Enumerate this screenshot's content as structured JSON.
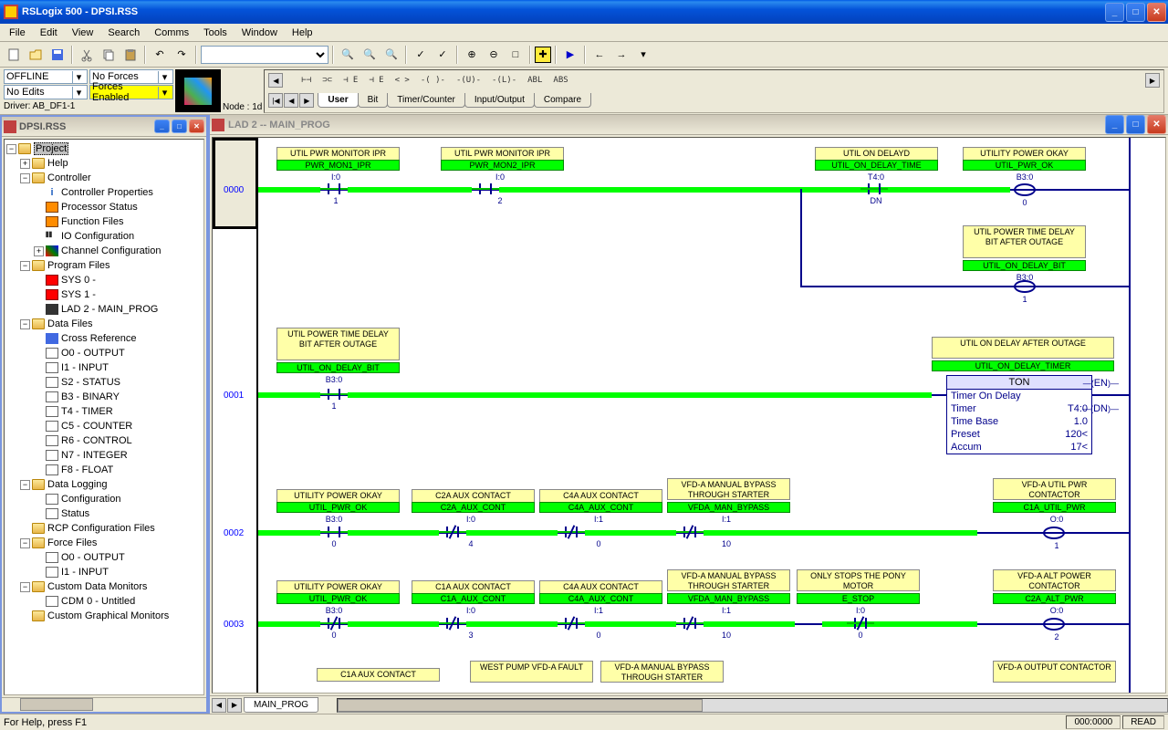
{
  "app": {
    "title": "RSLogix 500 - DPSI.RSS"
  },
  "menu": [
    "File",
    "Edit",
    "View",
    "Search",
    "Comms",
    "Tools",
    "Window",
    "Help"
  ],
  "status": {
    "mode": "OFFLINE",
    "forces": "No Forces",
    "edits": "No Edits",
    "forces_enabled": "Forces Enabled",
    "driver": "Driver: AB_DF1-1",
    "node": "Node :  1d"
  },
  "instr_symbols": [
    "⊢⊣",
    "⊃⊂",
    "⊣ E",
    "⊣ E",
    "< >",
    "-( )-",
    "-(U)-",
    "-(L)-",
    "ABL",
    "ABS"
  ],
  "instr_tabs": [
    "User",
    "Bit",
    "Timer/Counter",
    "Input/Output",
    "Compare"
  ],
  "tree_title": "DPSI.RSS",
  "tree": {
    "root": "Project",
    "help": "Help",
    "controller": "Controller",
    "controller_children": [
      "Controller Properties",
      "Processor Status",
      "Function Files",
      "IO Configuration",
      "Channel Configuration"
    ],
    "program_files": "Program Files",
    "pf_children": [
      "SYS 0 -",
      "SYS 1 -",
      "LAD 2 - MAIN_PROG"
    ],
    "data_files": "Data Files",
    "df_children": [
      "Cross Reference",
      "O0 - OUTPUT",
      "I1 - INPUT",
      "S2 - STATUS",
      "B3 - BINARY",
      "T4 - TIMER",
      "C5 - COUNTER",
      "R6 - CONTROL",
      "N7 - INTEGER",
      "F8 - FLOAT"
    ],
    "data_logging": "Data Logging",
    "dl_children": [
      "Configuration",
      "Status"
    ],
    "rcp": "RCP Configuration Files",
    "force_files": "Force Files",
    "ff_children": [
      "O0 - OUTPUT",
      "I1 - INPUT"
    ],
    "cdm": "Custom Data Monitors",
    "cdm_children": [
      "CDM 0 - Untitled"
    ],
    "cgm": "Custom Graphical Monitors"
  },
  "ladder": {
    "title": "LAD 2 -- MAIN_PROG",
    "tab": "MAIN_PROG",
    "rungs": [
      "0000",
      "0001",
      "0002",
      "0003"
    ],
    "r0": {
      "c1_desc": "UTIL PWR MONITOR IPR",
      "c1_tag": "PWR_MON1_IPR",
      "c1_addr": "I:0",
      "c1_bit": "1",
      "c2_desc": "UTIL PWR MONITOR IPR",
      "c2_tag": "PWR_MON2_IPR",
      "c2_addr": "I:0",
      "c2_bit": "2",
      "c3_desc": "UTIL ON DELAYD",
      "c3_tag": "UTIL_ON_DELAY_TIME",
      "c3_addr": "T4:0",
      "c3_bit": "DN",
      "o1_desc": "UTILITY POWER OKAY",
      "o1_tag": "UTIL_PWR_OK",
      "o1_addr": "B3:0",
      "o1_bit": "0",
      "o2_desc": "UTIL POWER TIME DELAY BIT AFTER OUTAGE",
      "o2_tag": "UTIL_ON_DELAY_BIT",
      "o2_addr": "B3:0",
      "o2_bit": "1"
    },
    "r1": {
      "c1_desc": "UTIL POWER TIME DELAY BIT AFTER OUTAGE",
      "c1_tag": "UTIL_ON_DELAY_BIT",
      "c1_addr": "B3:0",
      "c1_bit": "1",
      "o1_desc": "UTIL ON DELAY AFTER OUTAGE",
      "o1_tag": "UTIL_ON_DELAY_TIMER",
      "ton_title": "TON",
      "ton_name": "Timer On Delay",
      "ton_timer_l": "Timer",
      "ton_timer_v": "T4:0",
      "ton_base_l": "Time Base",
      "ton_base_v": "1.0",
      "ton_preset_l": "Preset",
      "ton_preset_v": "120<",
      "ton_accum_l": "Accum",
      "ton_accum_v": "17<",
      "en": "EN",
      "dn": "DN"
    },
    "r2": {
      "c1_desc": "UTILITY POWER OKAY",
      "c1_tag": "UTIL_PWR_OK",
      "c1_addr": "B3:0",
      "c1_bit": "0",
      "c2_desc": "C2A AUX CONTACT",
      "c2_tag": "C2A_AUX_CONT",
      "c2_addr": "I:0",
      "c2_bit": "4",
      "c3_desc": "C4A AUX CONTACT",
      "c3_tag": "C4A_AUX_CONT",
      "c3_addr": "I:1",
      "c3_bit": "0",
      "c4_desc": "VFD-A MANUAL BYPASS THROUGH STARTER",
      "c4_tag": "VFDA_MAN_BYPASS",
      "c4_addr": "I:1",
      "c4_bit": "10",
      "o1_desc": "VFD-A UTIL PWR CONTACTOR",
      "o1_tag": "C1A_UTIL_PWR",
      "o1_addr": "O:0",
      "o1_bit": "1"
    },
    "r3": {
      "c1_desc": "UTILITY POWER OKAY",
      "c1_tag": "UTIL_PWR_OK",
      "c1_addr": "B3:0",
      "c1_bit": "0",
      "c2_desc": "C1A AUX CONTACT",
      "c2_tag": "C1A_AUX_CONT",
      "c2_addr": "I:0",
      "c2_bit": "3",
      "c3_desc": "C4A AUX CONTACT",
      "c3_tag": "C4A_AUX_CONT",
      "c3_addr": "I:1",
      "c3_bit": "0",
      "c4_desc": "VFD-A MANUAL BYPASS THROUGH STARTER",
      "c4_tag": "VFDA_MAN_BYPASS",
      "c4_addr": "I:1",
      "c4_bit": "10",
      "c5_desc": "ONLY STOPS THE PONY MOTOR",
      "c5_tag": "E_STOP",
      "c5_addr": "I:0",
      "c5_bit": "0",
      "o1_desc": "VFD-A ALT POWER CONTACTOR",
      "o1_tag": "C2A_ALT_PWR",
      "o1_addr": "O:0",
      "o1_bit": "2"
    },
    "r4_partial": {
      "c1": "C1A AUX CONTACT",
      "c2": "WEST PUMP VFD-A FAULT",
      "c3": "VFD-A MANUAL BYPASS THROUGH STARTER",
      "o1": "VFD-A OUTPUT CONTACTOR"
    }
  },
  "statusbar": {
    "hint": "For Help, press F1",
    "pos": "000:0000",
    "mode": "READ"
  }
}
